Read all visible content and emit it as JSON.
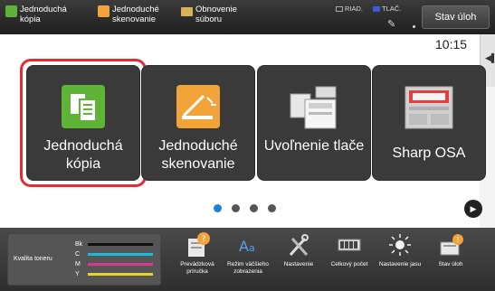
{
  "topbar": {
    "items": [
      {
        "label": "Jednoduchá kópia",
        "icon": "copy-icon"
      },
      {
        "label": "Jednoduché skenovanie",
        "icon": "scan-icon"
      },
      {
        "label": "Obnovenie súboru",
        "icon": "folder-icon"
      }
    ],
    "status": {
      "riad": "RIAD.",
      "tlac": "TLAČ."
    },
    "stav_uloh": "Stav úloh"
  },
  "clock": "10:15",
  "tiles": [
    {
      "label": "Jednoduchá kópia",
      "icon": "copy-doc-icon",
      "selected": true,
      "color": "#5fb336"
    },
    {
      "label": "Jednoduché skenovanie",
      "icon": "scanner-icon",
      "selected": false,
      "color": "#f2a33a"
    },
    {
      "label": "Uvoľnenie tlače",
      "icon": "printer-icon",
      "selected": false
    },
    {
      "label": "Sharp OSA",
      "icon": "osa-icon",
      "selected": false
    }
  ],
  "pages": {
    "count": 4,
    "active": 1
  },
  "bottombar": {
    "toner": {
      "label": "Kvalita toneru",
      "rows": [
        {
          "key": "Bk",
          "color": "#111111"
        },
        {
          "key": "C",
          "color": "#22b8d6"
        },
        {
          "key": "M",
          "color": "#d63a8f"
        },
        {
          "key": "Y",
          "color": "#e9d426"
        }
      ]
    },
    "items": [
      {
        "label": "Prevádzková príručka",
        "icon": "manual-icon"
      },
      {
        "label": "Režim väčšieho zobrazenia",
        "icon": "large-text-icon"
      },
      {
        "label": "Nastavenie",
        "icon": "settings-tools-icon"
      },
      {
        "label": "Celkový počet",
        "icon": "counter-icon"
      },
      {
        "label": "Nastavenie jasu",
        "icon": "brightness-icon"
      },
      {
        "label": "Stav úloh",
        "icon": "job-status-icon"
      }
    ]
  }
}
